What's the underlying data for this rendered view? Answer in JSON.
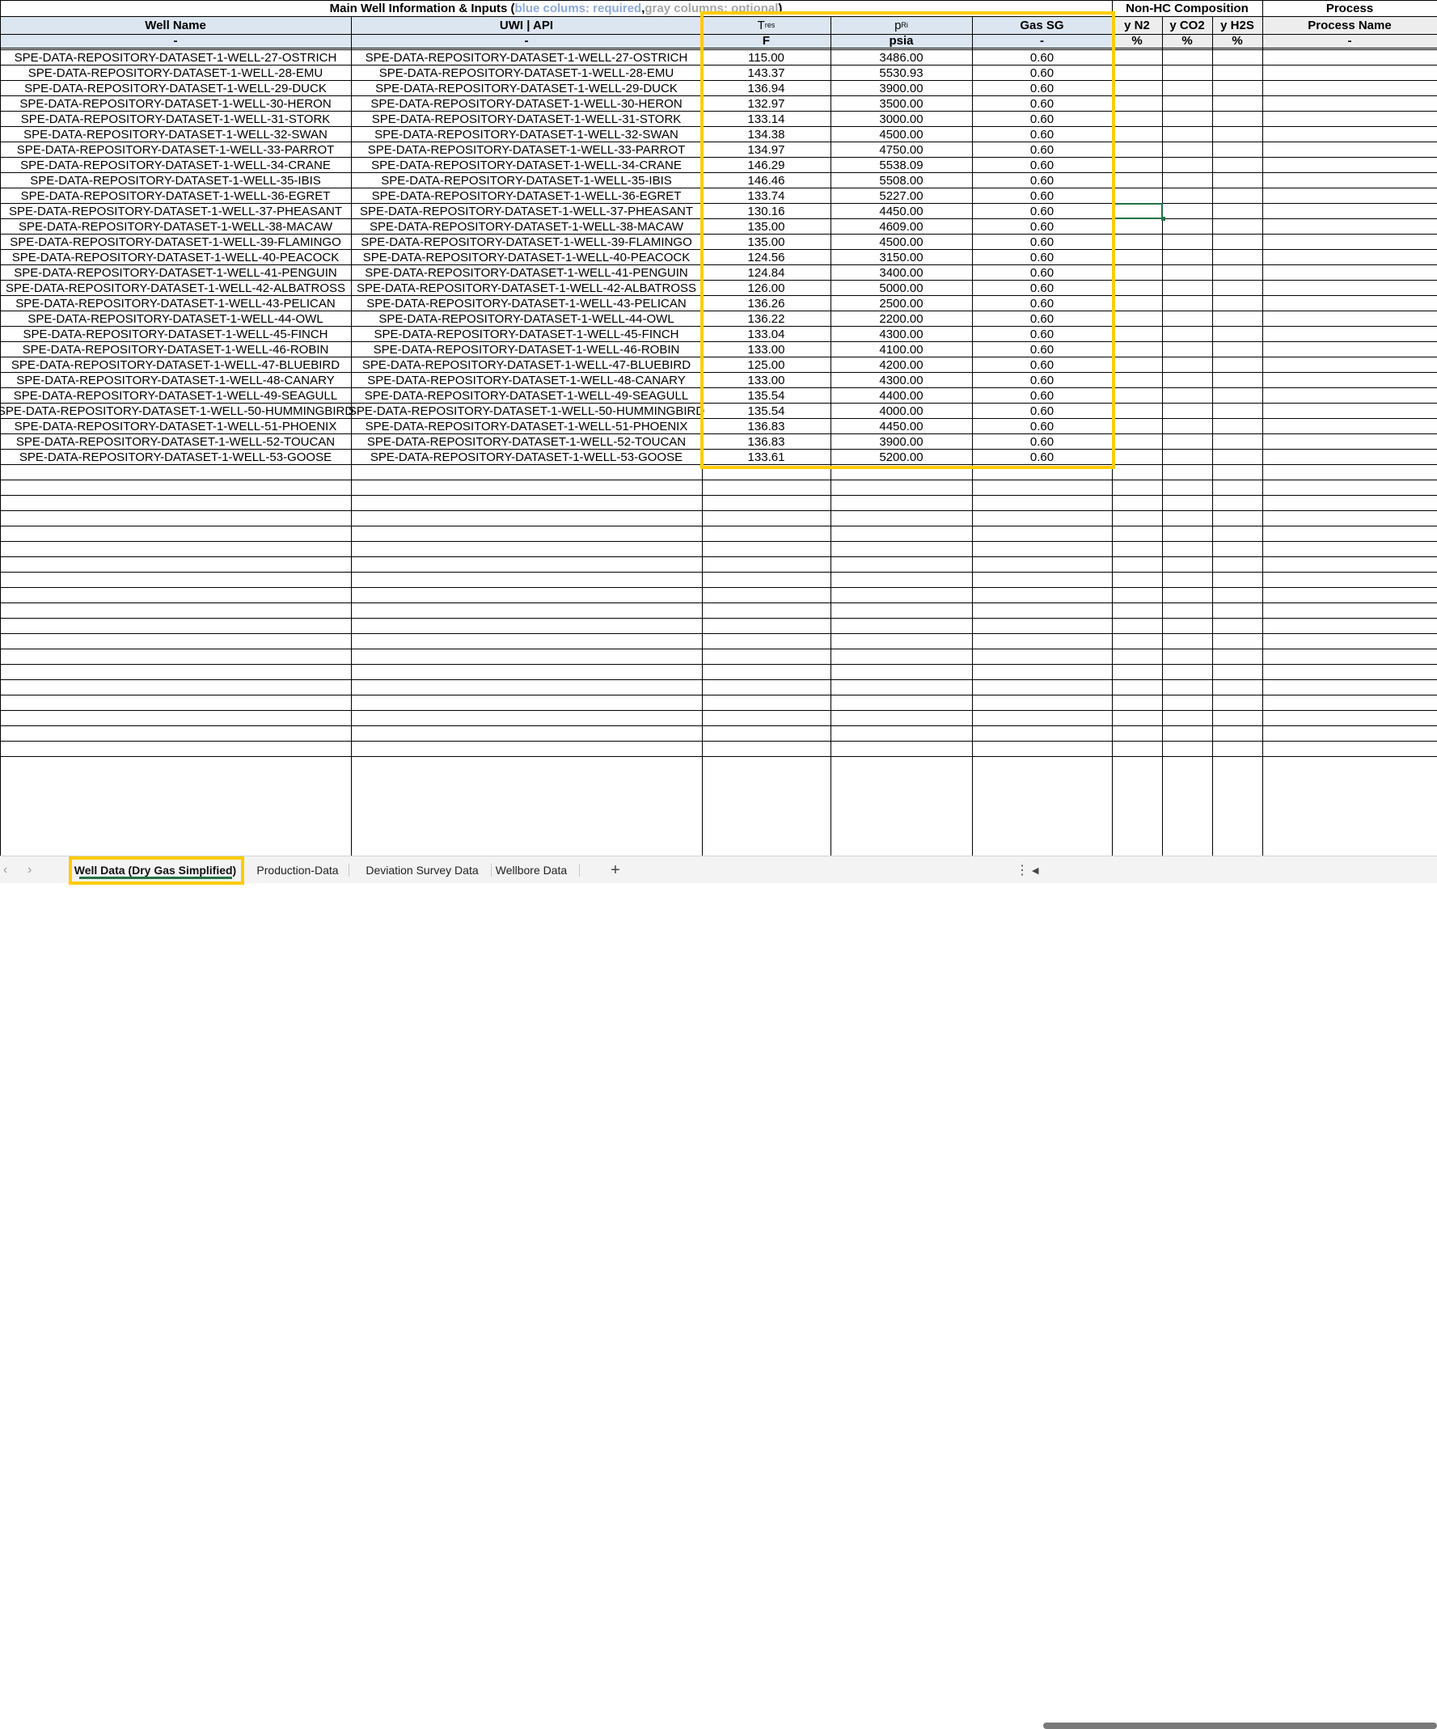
{
  "title": {
    "main": "Main Well Information & Inputs (",
    "blue": "blue colums: required",
    "sep": ", ",
    "gray": "gray columns: optional",
    "end": ")"
  },
  "groups": {
    "nonhc": "Non-HC Composition",
    "process": "Process"
  },
  "headers": {
    "well_name": "Well Name",
    "uwi": "UWI | API",
    "tres_main": "T",
    "tres_sub": "res",
    "pri_main": "p",
    "pri_sub": "Ri",
    "gas_sg": "Gas SG",
    "yn2": "y N2",
    "yco2": "y CO2",
    "yh2s": "y H2S",
    "process_name": "Process Name"
  },
  "units": {
    "well_name": "-",
    "uwi": "-",
    "tres": "F",
    "pri": "psia",
    "gas_sg": "-",
    "yn2": "%",
    "yco2": "%",
    "yh2s": "%",
    "process_name": "-"
  },
  "rows": [
    [
      "SPE-DATA-REPOSITORY-DATASET-1-WELL-27-OSTRICH",
      "SPE-DATA-REPOSITORY-DATASET-1-WELL-27-OSTRICH",
      "115.00",
      "3486.00",
      "0.60"
    ],
    [
      "SPE-DATA-REPOSITORY-DATASET-1-WELL-28-EMU",
      "SPE-DATA-REPOSITORY-DATASET-1-WELL-28-EMU",
      "143.37",
      "5530.93",
      "0.60"
    ],
    [
      "SPE-DATA-REPOSITORY-DATASET-1-WELL-29-DUCK",
      "SPE-DATA-REPOSITORY-DATASET-1-WELL-29-DUCK",
      "136.94",
      "3900.00",
      "0.60"
    ],
    [
      "SPE-DATA-REPOSITORY-DATASET-1-WELL-30-HERON",
      "SPE-DATA-REPOSITORY-DATASET-1-WELL-30-HERON",
      "132.97",
      "3500.00",
      "0.60"
    ],
    [
      "SPE-DATA-REPOSITORY-DATASET-1-WELL-31-STORK",
      "SPE-DATA-REPOSITORY-DATASET-1-WELL-31-STORK",
      "133.14",
      "3000.00",
      "0.60"
    ],
    [
      "SPE-DATA-REPOSITORY-DATASET-1-WELL-32-SWAN",
      "SPE-DATA-REPOSITORY-DATASET-1-WELL-32-SWAN",
      "134.38",
      "4500.00",
      "0.60"
    ],
    [
      "SPE-DATA-REPOSITORY-DATASET-1-WELL-33-PARROT",
      "SPE-DATA-REPOSITORY-DATASET-1-WELL-33-PARROT",
      "134.97",
      "4750.00",
      "0.60"
    ],
    [
      "SPE-DATA-REPOSITORY-DATASET-1-WELL-34-CRANE",
      "SPE-DATA-REPOSITORY-DATASET-1-WELL-34-CRANE",
      "146.29",
      "5538.09",
      "0.60"
    ],
    [
      "SPE-DATA-REPOSITORY-DATASET-1-WELL-35-IBIS",
      "SPE-DATA-REPOSITORY-DATASET-1-WELL-35-IBIS",
      "146.46",
      "5508.00",
      "0.60"
    ],
    [
      "SPE-DATA-REPOSITORY-DATASET-1-WELL-36-EGRET",
      "SPE-DATA-REPOSITORY-DATASET-1-WELL-36-EGRET",
      "133.74",
      "5227.00",
      "0.60"
    ],
    [
      "SPE-DATA-REPOSITORY-DATASET-1-WELL-37-PHEASANT",
      "SPE-DATA-REPOSITORY-DATASET-1-WELL-37-PHEASANT",
      "130.16",
      "4450.00",
      "0.60"
    ],
    [
      "SPE-DATA-REPOSITORY-DATASET-1-WELL-38-MACAW",
      "SPE-DATA-REPOSITORY-DATASET-1-WELL-38-MACAW",
      "135.00",
      "4609.00",
      "0.60"
    ],
    [
      "SPE-DATA-REPOSITORY-DATASET-1-WELL-39-FLAMINGO",
      "SPE-DATA-REPOSITORY-DATASET-1-WELL-39-FLAMINGO",
      "135.00",
      "4500.00",
      "0.60"
    ],
    [
      "SPE-DATA-REPOSITORY-DATASET-1-WELL-40-PEACOCK",
      "SPE-DATA-REPOSITORY-DATASET-1-WELL-40-PEACOCK",
      "124.56",
      "3150.00",
      "0.60"
    ],
    [
      "SPE-DATA-REPOSITORY-DATASET-1-WELL-41-PENGUIN",
      "SPE-DATA-REPOSITORY-DATASET-1-WELL-41-PENGUIN",
      "124.84",
      "3400.00",
      "0.60"
    ],
    [
      "SPE-DATA-REPOSITORY-DATASET-1-WELL-42-ALBATROSS",
      "SPE-DATA-REPOSITORY-DATASET-1-WELL-42-ALBATROSS",
      "126.00",
      "5000.00",
      "0.60"
    ],
    [
      "SPE-DATA-REPOSITORY-DATASET-1-WELL-43-PELICAN",
      "SPE-DATA-REPOSITORY-DATASET-1-WELL-43-PELICAN",
      "136.26",
      "2500.00",
      "0.60"
    ],
    [
      "SPE-DATA-REPOSITORY-DATASET-1-WELL-44-OWL",
      "SPE-DATA-REPOSITORY-DATASET-1-WELL-44-OWL",
      "136.22",
      "2200.00",
      "0.60"
    ],
    [
      "SPE-DATA-REPOSITORY-DATASET-1-WELL-45-FINCH",
      "SPE-DATA-REPOSITORY-DATASET-1-WELL-45-FINCH",
      "133.04",
      "4300.00",
      "0.60"
    ],
    [
      "SPE-DATA-REPOSITORY-DATASET-1-WELL-46-ROBIN",
      "SPE-DATA-REPOSITORY-DATASET-1-WELL-46-ROBIN",
      "133.00",
      "4100.00",
      "0.60"
    ],
    [
      "SPE-DATA-REPOSITORY-DATASET-1-WELL-47-BLUEBIRD",
      "SPE-DATA-REPOSITORY-DATASET-1-WELL-47-BLUEBIRD",
      "125.00",
      "4200.00",
      "0.60"
    ],
    [
      "SPE-DATA-REPOSITORY-DATASET-1-WELL-48-CANARY",
      "SPE-DATA-REPOSITORY-DATASET-1-WELL-48-CANARY",
      "133.00",
      "4300.00",
      "0.60"
    ],
    [
      "SPE-DATA-REPOSITORY-DATASET-1-WELL-49-SEAGULL",
      "SPE-DATA-REPOSITORY-DATASET-1-WELL-49-SEAGULL",
      "135.54",
      "4400.00",
      "0.60"
    ],
    [
      "SPE-DATA-REPOSITORY-DATASET-1-WELL-50-HUMMINGBIRD",
      "SPE-DATA-REPOSITORY-DATASET-1-WELL-50-HUMMINGBIRD",
      "135.54",
      "4000.00",
      "0.60"
    ],
    [
      "SPE-DATA-REPOSITORY-DATASET-1-WELL-51-PHOENIX",
      "SPE-DATA-REPOSITORY-DATASET-1-WELL-51-PHOENIX",
      "136.83",
      "4450.00",
      "0.60"
    ],
    [
      "SPE-DATA-REPOSITORY-DATASET-1-WELL-52-TOUCAN",
      "SPE-DATA-REPOSITORY-DATASET-1-WELL-52-TOUCAN",
      "136.83",
      "3900.00",
      "0.60"
    ],
    [
      "SPE-DATA-REPOSITORY-DATASET-1-WELL-53-GOOSE",
      "SPE-DATA-REPOSITORY-DATASET-1-WELL-53-GOOSE",
      "133.61",
      "5200.00",
      "0.60"
    ]
  ],
  "tabs": [
    {
      "label": "Well Data (Dry Gas Simplified)",
      "active": true
    },
    {
      "label": "Production-Data",
      "active": false
    },
    {
      "label": "Deviation Survey Data",
      "active": false
    },
    {
      "label": "Wellbore Data",
      "active": false
    }
  ],
  "toolbar": {
    "add_sheet": "+",
    "more": "⋮",
    "prev": "‹",
    "next": "›",
    "scroll_left": "◀"
  },
  "colors": {
    "highlight": "#ffcc00",
    "header_blue": "#dce6f1",
    "header_gray": "#ededed",
    "selection": "#217346"
  }
}
